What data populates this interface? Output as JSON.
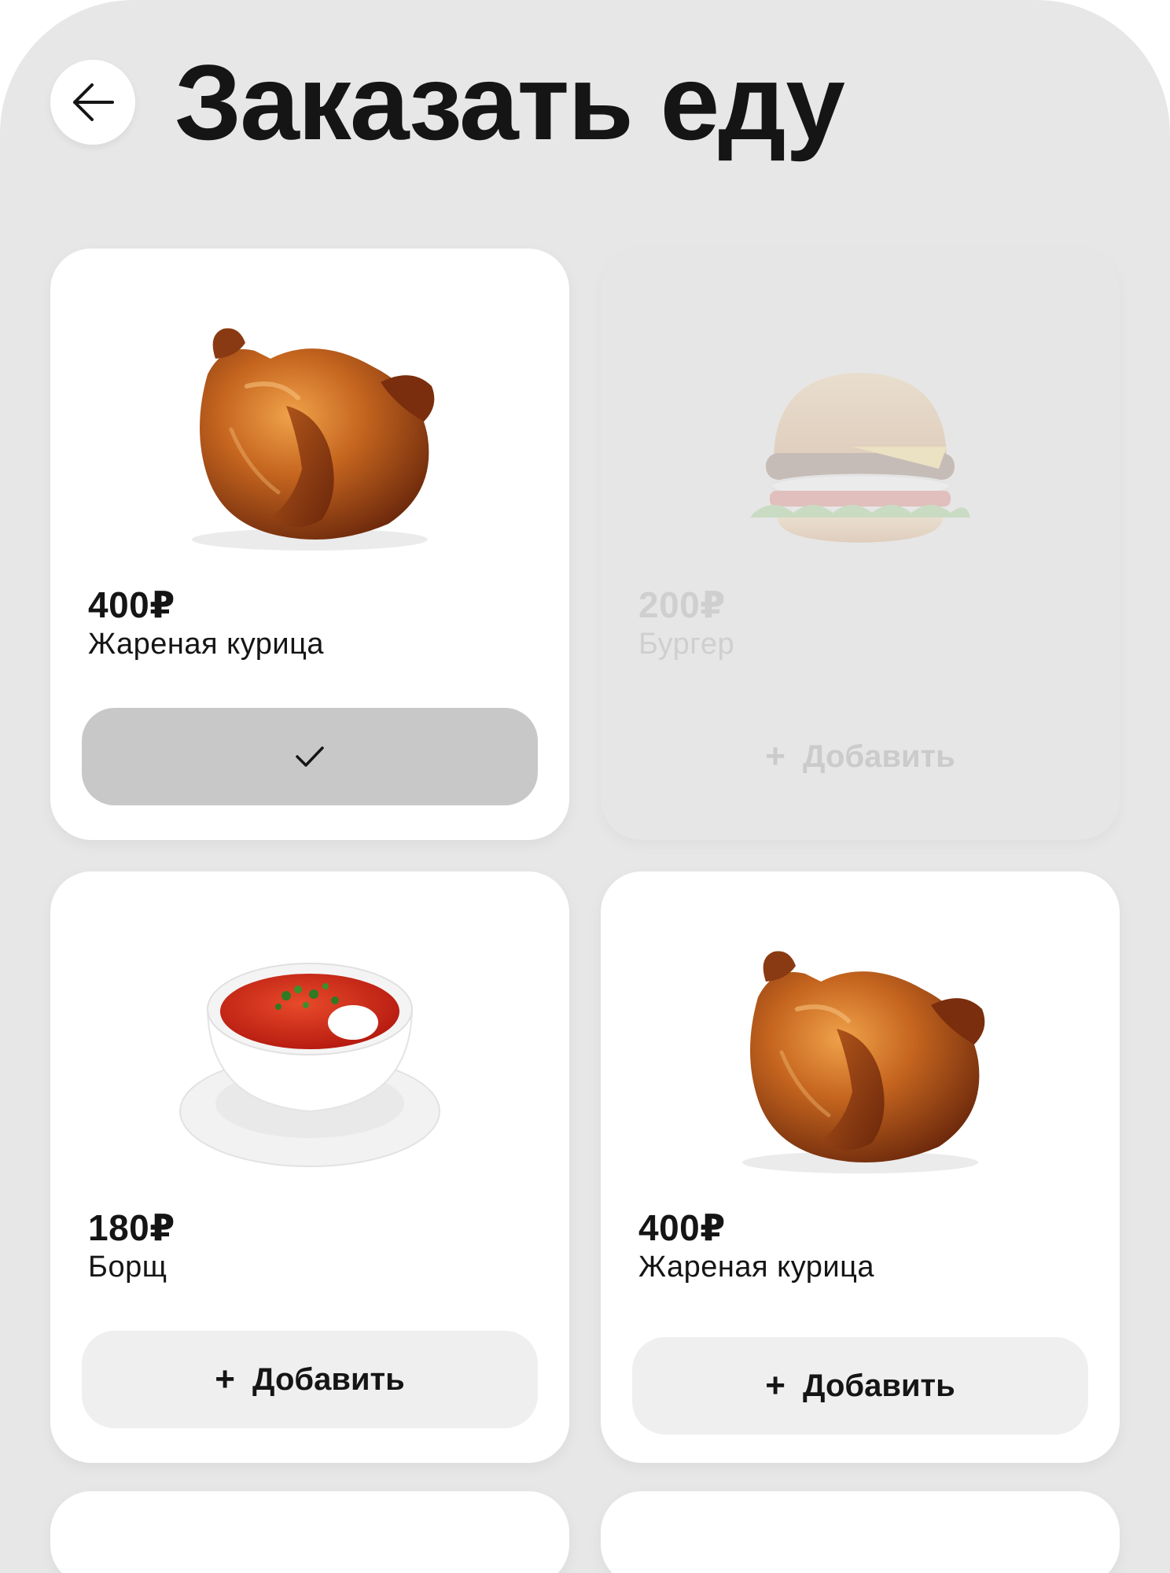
{
  "header": {
    "title": "Заказать еду",
    "back_icon": "arrow-left-icon"
  },
  "colors": {
    "background": "#e7e7e7",
    "card": "#ffffff",
    "button": "#efefef",
    "button_selected": "#c8c8c8",
    "text": "#151515"
  },
  "products": [
    {
      "price": "400₽",
      "name": "Жареная курица",
      "image": "roast-chicken",
      "state": "selected",
      "button_icon": "check-icon"
    },
    {
      "price": "200₽",
      "name": "Бургер",
      "image": "burger",
      "state": "disabled",
      "button_label": "Добавить",
      "button_icon": "plus-icon"
    },
    {
      "price": "180₽",
      "name": "Борщ",
      "image": "borscht",
      "state": "default",
      "button_label": "Добавить",
      "button_icon": "plus-icon"
    },
    {
      "price": "400₽",
      "name": "Жареная курица",
      "image": "roast-chicken",
      "state": "default",
      "button_label": "Добавить",
      "button_icon": "plus-icon"
    }
  ]
}
